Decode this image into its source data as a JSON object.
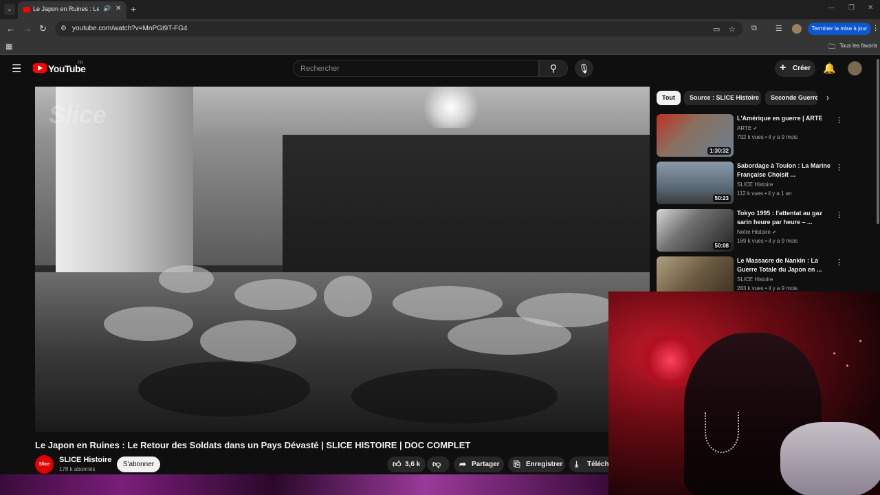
{
  "browser": {
    "tab_title": "Le Japon en Ruines : Le Retour",
    "url": "youtube.com/watch?v=MnPGI9T-FG4",
    "update_label": "Terminer la mise à jour",
    "bookmarks_label": "Tous les favoris"
  },
  "header": {
    "logo_text": "YouTube",
    "region": "FR",
    "search_placeholder": "Rechercher",
    "create_label": "Créer"
  },
  "video": {
    "title": "Le Japon en Ruines : Le Retour des Soldats dans un Pays Dévasté | SLICE HISTOIRE | DOC COMPLET",
    "watermark": "Slice",
    "channel_avatar_text": "Slice",
    "channel_name": "SLICE Histoire",
    "subscribers": "178 k abonnés",
    "subscribe_label": "S'abonner",
    "likes": "3,6 k",
    "share_label": "Partager",
    "save_label": "Enregistrer",
    "download_label": "Télécha"
  },
  "chips": [
    {
      "label": "Tout",
      "active": true
    },
    {
      "label": "Source : SLICE Histoire",
      "active": false
    },
    {
      "label": "Seconde Guerre",
      "active": false
    }
  ],
  "recommendations": [
    {
      "title": "L'Amérique en guerre | ARTE",
      "channel": "ARTE",
      "verified": true,
      "meta": "792 k vues • il y a 9 mois",
      "duration": "1:30:32",
      "thumb_color": "#7a5a50"
    },
    {
      "title": "Sabordage à Toulon : La Marine Française Choisit ...",
      "channel": "SLICE Histoire",
      "verified": false,
      "meta": "112 k vues • il y a 1 an",
      "duration": "50:23",
      "thumb_color": "#6a7a88"
    },
    {
      "title": "Tokyo 1995 : l'attentat au gaz sarin heure par heure – ...",
      "channel": "Notre Histoire",
      "verified": true,
      "meta": "169 k vues • il y a 9 mois",
      "duration": "50:08",
      "thumb_color": "#505050"
    },
    {
      "title": "Le Massacre de Nankin : La Guerre Totale du Japon en ...",
      "channel": "SLICE Histoire",
      "verified": false,
      "meta": "283 k vues • il y a 9 mois",
      "duration": "",
      "thumb_color": "#6a5a40"
    }
  ],
  "colors": {
    "accent_red": "#ff0000",
    "update_blue": "#0b57d0",
    "background": "#0f0f0f"
  }
}
